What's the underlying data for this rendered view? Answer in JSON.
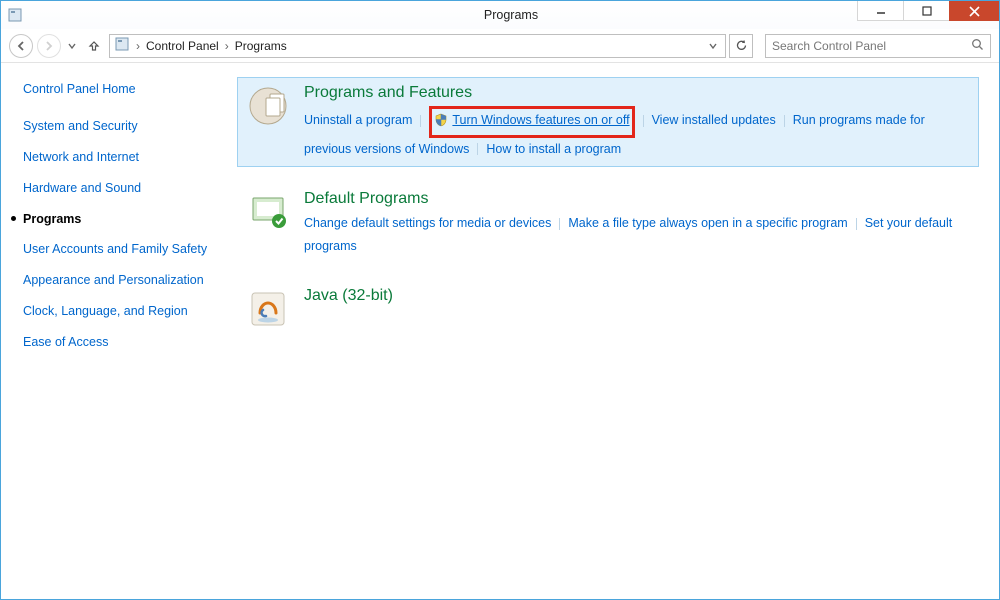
{
  "window": {
    "title": "Programs"
  },
  "breadcrumb": {
    "root": "Control Panel",
    "current": "Programs"
  },
  "search": {
    "placeholder": "Search Control Panel"
  },
  "sidebar": {
    "items": [
      {
        "label": "Control Panel Home",
        "active": false
      },
      {
        "label": "System and Security",
        "active": false
      },
      {
        "label": "Network and Internet",
        "active": false
      },
      {
        "label": "Hardware and Sound",
        "active": false
      },
      {
        "label": "Programs",
        "active": true
      },
      {
        "label": "User Accounts and Family Safety",
        "active": false
      },
      {
        "label": "Appearance and Personalization",
        "active": false
      },
      {
        "label": "Clock, Language, and Region",
        "active": false
      },
      {
        "label": "Ease of Access",
        "active": false
      }
    ]
  },
  "categories": [
    {
      "title": "Programs and Features",
      "selected": true,
      "links": [
        {
          "label": "Uninstall a program",
          "shield": false,
          "highlight": false
        },
        {
          "label": "Turn Windows features on or off",
          "shield": true,
          "highlight": true
        },
        {
          "label": "View installed updates",
          "shield": false,
          "highlight": false
        },
        {
          "label": "Run programs made for previous versions of Windows",
          "shield": false,
          "highlight": false
        },
        {
          "label": "How to install a program",
          "shield": false,
          "highlight": false
        }
      ]
    },
    {
      "title": "Default Programs",
      "selected": false,
      "links": [
        {
          "label": "Change default settings for media or devices",
          "shield": false,
          "highlight": false
        },
        {
          "label": "Make a file type always open in a specific program",
          "shield": false,
          "highlight": false
        },
        {
          "label": "Set your default programs",
          "shield": false,
          "highlight": false
        }
      ]
    },
    {
      "title": "Java (32-bit)",
      "selected": false,
      "links": []
    }
  ]
}
